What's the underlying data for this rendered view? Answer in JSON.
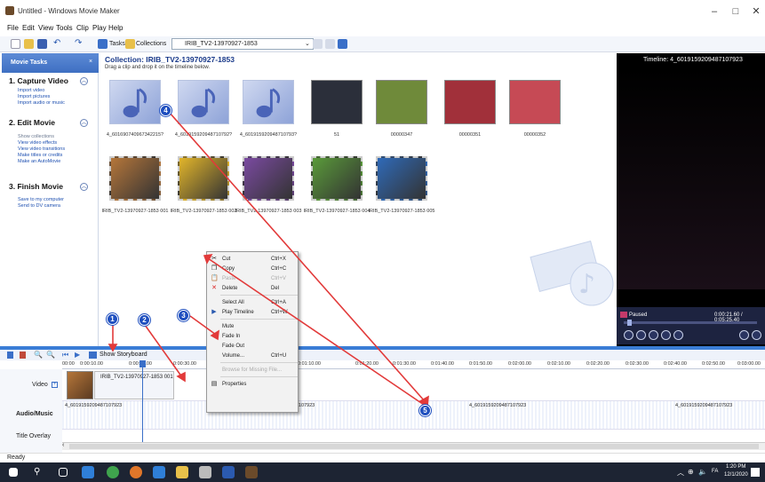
{
  "window": {
    "title": "Untitled - Windows Movie Maker",
    "minimize": "–",
    "maximize": "□",
    "close": "✕"
  },
  "menu": [
    "File",
    "Edit",
    "View",
    "Tools",
    "Clip",
    "Play",
    "Help"
  ],
  "toolbar": {
    "tasks": "Tasks",
    "collections": "Collections",
    "collection_value": "IRIB_TV2-13970927-1853"
  },
  "tasks_pane": {
    "header": "Movie Tasks",
    "close": "×",
    "sections": [
      {
        "title": "1. Capture Video",
        "links": [
          "Import video",
          "Import pictures",
          "Import audio or music"
        ],
        "dim": false
      },
      {
        "title": "2. Edit Movie",
        "links": [
          "Show collections",
          "View video effects",
          "View video transitions",
          "Make titles or credits",
          "Make an AutoMovie"
        ],
        "dim": true
      },
      {
        "title": "3. Finish Movie",
        "links": [
          "Save to my computer",
          "Send to DV camera"
        ],
        "dim": false
      }
    ]
  },
  "collection": {
    "title": "Collection: IRIB_TV2-13970927-1853",
    "subtitle": "Drag a clip and drop it on the timeline below.",
    "clips_row1": [
      {
        "label": "4_601690740967342215?",
        "kind": "music"
      },
      {
        "label": "4_601915920948710792?",
        "kind": "music"
      },
      {
        "label": "4_601915920948710793?",
        "kind": "music"
      },
      {
        "label": "51",
        "kind": "photo",
        "color": "#2b2f3a"
      },
      {
        "label": "00000347",
        "kind": "photo",
        "color": "#6f8a3a"
      },
      {
        "label": "00000351",
        "kind": "photo",
        "color": "#a1303a"
      },
      {
        "label": "00000352",
        "kind": "photo",
        "color": "#c64a55"
      }
    ],
    "clips_row2": [
      {
        "label": "IRIB_TV2-13970927-1853 001",
        "color": "#b5763a"
      },
      {
        "label": "IRIB_TV2-13970927-1853 002",
        "color": "#e2b52a"
      },
      {
        "label": "IRIB_TV2-13970927-1853 003",
        "color": "#7a4aa0"
      },
      {
        "label": "IRIB_TV2-13970927-1853 004",
        "color": "#5a9a3a"
      },
      {
        "label": "IRIB_TV2-13970927-1853 005",
        "color": "#2f6ab8"
      }
    ]
  },
  "monitor": {
    "title": "Timeline: 4_6019159209487107923",
    "status": "Paused",
    "time": "0:00:21.60 / 0:05:25.40"
  },
  "timeline": {
    "show_storyboard": "Show Storyboard",
    "ticks": [
      "00:00",
      "0:00:10.00",
      "0:00:20.00",
      "0:00:30.00",
      "0:01:10.00",
      "0:01:20.00",
      "0:01:30.00",
      "0:01:40.00",
      "0:01:50.00",
      "0:02:00.00",
      "0:02:10.00",
      "0:02:20.00",
      "0:02:30.00",
      "0:02:40.00",
      "0:02:50.00",
      "0:03:00.00"
    ],
    "video_label": "Video",
    "audio_label": "Audio/Music",
    "overlay_label": "Title Overlay",
    "video_clip": "IRIB_TV2-13970927-1853 001",
    "audio_clips": [
      "4_6019159209487107923",
      "4_6019159209487107923",
      "4_6019159209487107923",
      "4_6019159209487107923"
    ]
  },
  "context_menu": {
    "items": [
      {
        "label": "Cut",
        "shortcut": "Ctrl+X",
        "disabled": false,
        "icon": "cut-icon"
      },
      {
        "label": "Copy",
        "shortcut": "Ctrl+C",
        "disabled": false,
        "icon": "copy-icon"
      },
      {
        "label": "Paste",
        "shortcut": "Ctrl+V",
        "disabled": true,
        "icon": "paste-icon"
      },
      {
        "label": "Delete",
        "shortcut": "Del",
        "disabled": false,
        "icon": "delete-icon"
      },
      {
        "label": "Select All",
        "shortcut": "Ctrl+A",
        "disabled": false,
        "icon": ""
      },
      {
        "label": "Play Timeline",
        "shortcut": "Ctrl+W",
        "disabled": false,
        "icon": "play-icon"
      },
      {
        "label": "Mute",
        "shortcut": "",
        "disabled": false,
        "icon": ""
      },
      {
        "label": "Fade In",
        "shortcut": "",
        "disabled": false,
        "icon": ""
      },
      {
        "label": "Fade Out",
        "shortcut": "",
        "disabled": false,
        "icon": ""
      },
      {
        "label": "Volume...",
        "shortcut": "Ctrl+U",
        "disabled": false,
        "icon": ""
      },
      {
        "label": "Browse for Missing File...",
        "shortcut": "",
        "disabled": true,
        "icon": ""
      },
      {
        "label": "Properties",
        "shortcut": "",
        "disabled": false,
        "icon": "properties-icon"
      }
    ]
  },
  "annotations": [
    "1",
    "2",
    "3",
    "4",
    "5"
  ],
  "statusbar": {
    "text": "Ready"
  },
  "taskbar": {
    "time": "1:20 PM",
    "date": "12/1/2020",
    "lang": "FA"
  }
}
